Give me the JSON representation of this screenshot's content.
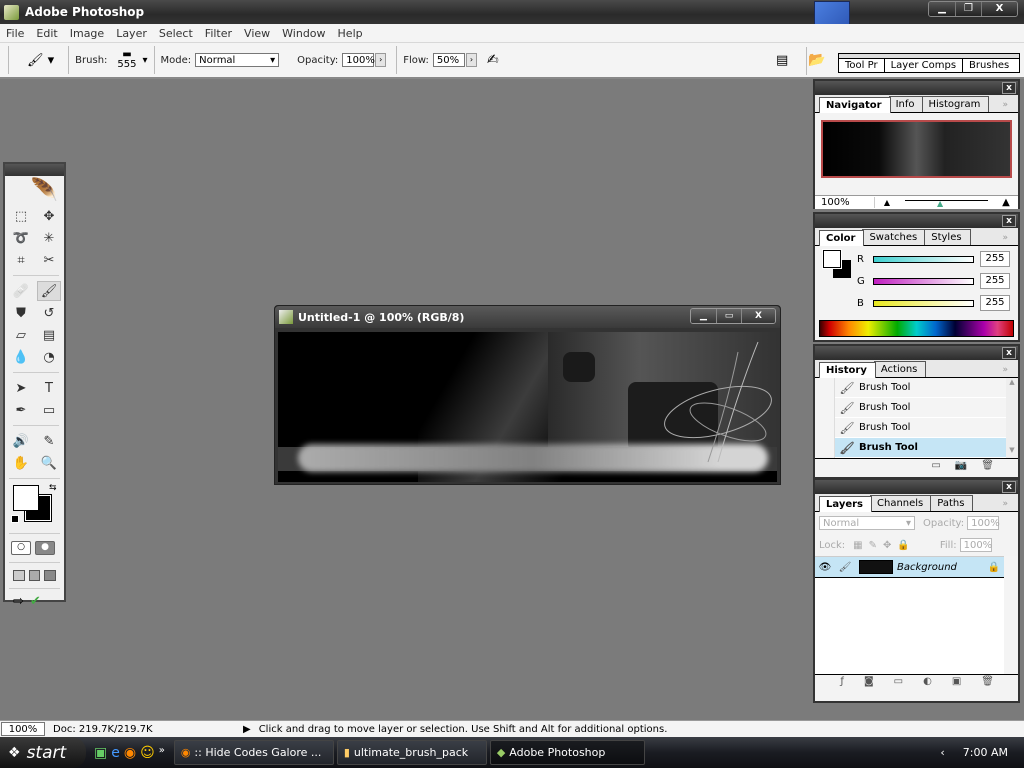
{
  "app": {
    "title": "Adobe Photoshop",
    "window_controls": [
      "minimize",
      "restore",
      "close"
    ]
  },
  "menu": [
    "File",
    "Edit",
    "Image",
    "Layer",
    "Select",
    "Filter",
    "View",
    "Window",
    "Help"
  ],
  "options": {
    "brush_label": "Brush:",
    "brush_size": "555",
    "mode_label": "Mode:",
    "mode_value": "Normal",
    "opacity_label": "Opacity:",
    "opacity_value": "100%",
    "flow_label": "Flow:",
    "flow_value": "50%",
    "panel_well_tabs": [
      "Tool Pr",
      "Layer Comps",
      "Brushes"
    ]
  },
  "toolbox": {
    "tools": [
      {
        "name": "marquee",
        "glyph": "⬚"
      },
      {
        "name": "move",
        "glyph": "✥"
      },
      {
        "name": "lasso",
        "glyph": "➰"
      },
      {
        "name": "magic-wand",
        "glyph": "✳"
      },
      {
        "name": "crop",
        "glyph": "⌗"
      },
      {
        "name": "slice",
        "glyph": "✂"
      },
      {
        "name": "healing-brush",
        "glyph": "🩹"
      },
      {
        "name": "brush",
        "glyph": "🖌"
      },
      {
        "name": "clone-stamp",
        "glyph": "⛊"
      },
      {
        "name": "history-brush",
        "glyph": "↺"
      },
      {
        "name": "eraser",
        "glyph": "▱"
      },
      {
        "name": "gradient",
        "glyph": "▤"
      },
      {
        "name": "blur",
        "glyph": "💧"
      },
      {
        "name": "dodge",
        "glyph": "◔"
      },
      {
        "name": "path-selection",
        "glyph": "➤"
      },
      {
        "name": "type",
        "glyph": "T"
      },
      {
        "name": "pen",
        "glyph": "✒"
      },
      {
        "name": "shape",
        "glyph": "▭"
      },
      {
        "name": "notes",
        "glyph": "🔊"
      },
      {
        "name": "eyedropper",
        "glyph": "✎"
      },
      {
        "name": "hand",
        "glyph": "✋"
      },
      {
        "name": "zoom",
        "glyph": "🔍"
      }
    ],
    "foreground": "#ffffff",
    "background": "#000000"
  },
  "document": {
    "title": "Untitled-1 @ 100% (RGB/8)"
  },
  "navigator": {
    "tabs": [
      "Navigator",
      "Info",
      "Histogram"
    ],
    "zoom": "100%"
  },
  "color": {
    "tabs": [
      "Color",
      "Swatches",
      "Styles"
    ],
    "channels": [
      {
        "label": "R",
        "value": "255",
        "from": "#40d0d0",
        "to": "#ffffff"
      },
      {
        "label": "G",
        "value": "255",
        "from": "#c020c0",
        "to": "#ffffff"
      },
      {
        "label": "B",
        "value": "255",
        "from": "#e8e820",
        "to": "#ffffff"
      }
    ]
  },
  "history": {
    "tabs": [
      "History",
      "Actions"
    ],
    "items": [
      "Brush Tool",
      "Brush Tool",
      "Brush Tool",
      "Brush Tool"
    ]
  },
  "layers": {
    "tabs": [
      "Layers",
      "Channels",
      "Paths"
    ],
    "blend_mode": "Normal",
    "opacity_label": "Opacity:",
    "opacity": "100%",
    "lock_label": "Lock:",
    "fill_label": "Fill:",
    "fill": "100%",
    "items": [
      {
        "name": "Background",
        "visible": true,
        "locked": true
      }
    ]
  },
  "status": {
    "zoom": "100%",
    "doc": "Doc: 219.7K/219.7K",
    "hint": "Click and drag to move layer or selection.  Use Shift and Alt for additional options."
  },
  "taskbar": {
    "start": "start",
    "buttons": [
      ":: Hide Codes Galore ...",
      "ultimate_brush_pack",
      "Adobe Photoshop"
    ],
    "time": "7:00 AM"
  }
}
